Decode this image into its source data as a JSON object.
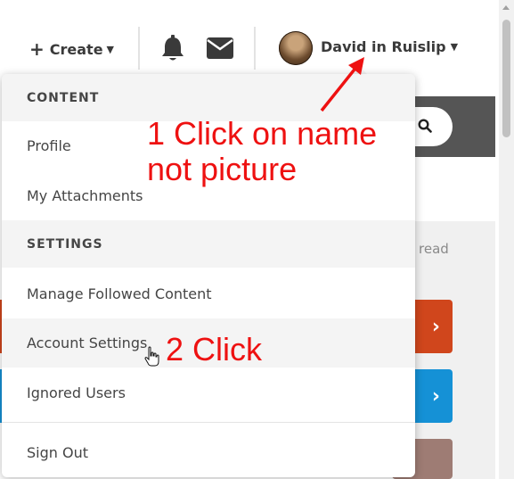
{
  "topbar": {
    "create_label": "Create",
    "user_name": "David in Ruislip",
    "icons": [
      "plus-icon",
      "caret-down-icon",
      "bell-icon",
      "envelope-icon",
      "avatar",
      "caret-down-icon"
    ]
  },
  "background": {
    "read_label": "read",
    "chevron": "›",
    "accent_orange": "#d0461c",
    "accent_blue": "#1591d6"
  },
  "menu": {
    "content_header": "CONTENT",
    "content_items": [
      "Profile",
      "My Attachments"
    ],
    "settings_header": "SETTINGS",
    "settings_items": [
      "Manage Followed Content",
      "Account Settings",
      "Ignored Users"
    ],
    "sign_out": "Sign Out",
    "hovered_item": "Account Settings"
  },
  "annotations": {
    "step1_line1": "1 Click on name",
    "step1_line2": "not picture",
    "step2": "2 Click",
    "color": "#ee1111"
  }
}
